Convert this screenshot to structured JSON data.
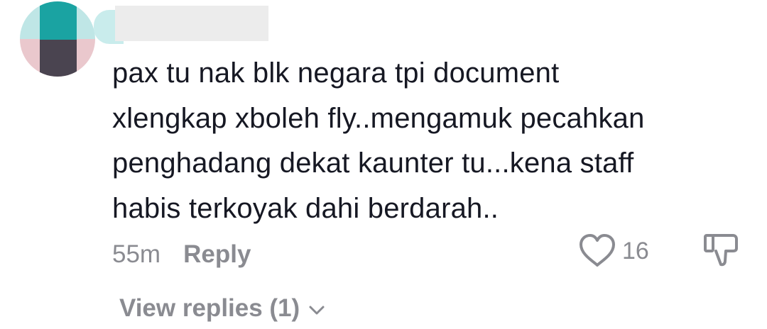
{
  "comment": {
    "lines": [
      "pax tu nak blk negara tpi document",
      "xlengkap xboleh fly..mengamuk pecahkan",
      "penghadang dekat kaunter tu...kena staff",
      "habis terkoyak dahi berdarah.."
    ],
    "timestamp": "55m",
    "reply_label": "Reply",
    "like_count": "16",
    "view_replies_label": "View replies (1)"
  },
  "icons": {
    "like": "heart-outline-icon",
    "dislike": "thumbs-down-outline-icon",
    "expand": "chevron-down-icon"
  },
  "colors": {
    "text": "#161823",
    "muted": "#8a8b91"
  }
}
